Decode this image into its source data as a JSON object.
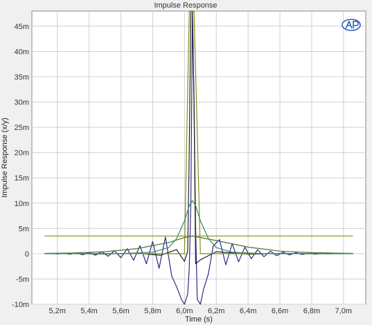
{
  "chart_data": {
    "type": "line",
    "title": "Impulse Response",
    "xlabel": "Time (s)",
    "ylabel": "Impulse Response (x/y)",
    "xlim": [
      5.04,
      7.14
    ],
    "ylim": [
      -10,
      48
    ],
    "x_unit": "ms-scaled seconds (m)",
    "y_unit": "m",
    "x_ticks": [
      {
        "v": 5.2,
        "label": "5,2m"
      },
      {
        "v": 5.4,
        "label": "5,4m"
      },
      {
        "v": 5.6,
        "label": "5,6m"
      },
      {
        "v": 5.8,
        "label": "5,8m"
      },
      {
        "v": 6.0,
        "label": "6,0m"
      },
      {
        "v": 6.2,
        "label": "6,2m"
      },
      {
        "v": 6.4,
        "label": "6,4m"
      },
      {
        "v": 6.6,
        "label": "6,6m"
      },
      {
        "v": 6.8,
        "label": "6,8m"
      },
      {
        "v": 7.0,
        "label": "7,0m"
      }
    ],
    "y_ticks": [
      {
        "v": 45,
        "label": "45m"
      },
      {
        "v": 40,
        "label": "40m"
      },
      {
        "v": 35,
        "label": "35m"
      },
      {
        "v": 30,
        "label": "30m"
      },
      {
        "v": 25,
        "label": "25m"
      },
      {
        "v": 20,
        "label": "20m"
      },
      {
        "v": 15,
        "label": "15m"
      },
      {
        "v": 10,
        "label": "10m"
      },
      {
        "v": 5,
        "label": "5m"
      },
      {
        "v": 0,
        "label": "0"
      },
      {
        "v": -5,
        "label": "-5m"
      },
      {
        "v": -10,
        "label": "-10m"
      }
    ],
    "grid": true,
    "series": [
      {
        "color": "#2a2a8a",
        "x": [
          5.12,
          5.16,
          5.2,
          5.24,
          5.28,
          5.32,
          5.36,
          5.4,
          5.44,
          5.48,
          5.52,
          5.56,
          5.6,
          5.64,
          5.68,
          5.72,
          5.76,
          5.8,
          5.84,
          5.88,
          5.92,
          5.95,
          5.98,
          6.0,
          6.02,
          6.03,
          6.04,
          6.05,
          6.06,
          6.07,
          6.08,
          6.1,
          6.12,
          6.15,
          6.18,
          6.22,
          6.26,
          6.3,
          6.34,
          6.38,
          6.42,
          6.46,
          6.5,
          6.54,
          6.58,
          6.62,
          6.66,
          6.7,
          6.74,
          6.78,
          6.82,
          6.86,
          6.9,
          6.94,
          6.98,
          7.02,
          7.06
        ],
        "y": [
          0,
          0.05,
          -0.05,
          0.08,
          -0.1,
          0.15,
          -0.2,
          0.25,
          -0.3,
          0.4,
          -0.5,
          0.6,
          -0.8,
          1.0,
          -1.3,
          1.6,
          -2.0,
          2.4,
          -2.9,
          3.3,
          -4.5,
          -6.5,
          -9,
          -10,
          -8,
          -3,
          10,
          48,
          30,
          5,
          -9,
          -10,
          -7,
          -4,
          1.5,
          2.8,
          -2.2,
          2.0,
          -1.6,
          1.3,
          -1.0,
          0.8,
          -0.6,
          0.5,
          -0.4,
          0.3,
          -0.25,
          0.2,
          -0.15,
          0.1,
          -0.08,
          0.05,
          -0.04,
          0.03,
          -0.02,
          0.01,
          0
        ]
      },
      {
        "color": "#222222",
        "x": [
          5.12,
          5.3,
          5.5,
          5.7,
          5.85,
          5.95,
          6.0,
          6.02,
          6.03,
          6.04,
          6.05,
          6.06,
          6.07,
          6.1,
          6.2,
          6.4,
          6.6,
          6.8,
          7.06
        ],
        "y": [
          0,
          0.02,
          -0.05,
          0.1,
          -0.3,
          0.8,
          -1.5,
          0.5,
          20,
          48,
          48,
          30,
          -2,
          -1.2,
          0.4,
          -0.1,
          0.05,
          -0.02,
          0
        ]
      },
      {
        "color": "#8a8a1a",
        "x": [
          5.12,
          5.2,
          5.4,
          5.6,
          5.8,
          5.95,
          6.0,
          6.03,
          6.04,
          6.05,
          6.06,
          6.1,
          6.3,
          6.5,
          6.7,
          6.9,
          7.06
        ],
        "y": [
          0,
          0,
          0,
          0,
          0,
          0,
          0,
          48,
          48,
          48,
          48,
          0,
          0,
          0,
          0,
          0,
          0
        ]
      },
      {
        "color": "#8a8a1a",
        "x": [
          5.12,
          7.06
        ],
        "y": [
          3.5,
          3.5
        ]
      },
      {
        "color": "#556b2f",
        "x": [
          5.12,
          5.3,
          5.5,
          5.7,
          5.9,
          6.0,
          6.05,
          6.1,
          6.2,
          6.4,
          6.6,
          6.8,
          7.06
        ],
        "y": [
          0.05,
          0.15,
          0.4,
          1.0,
          2.2,
          3.2,
          3.5,
          3.2,
          2.6,
          1.3,
          0.5,
          0.2,
          0.05
        ]
      },
      {
        "color": "#2e8b57",
        "x": [
          5.12,
          5.6,
          5.8,
          5.9,
          5.95,
          6.0,
          6.03,
          6.05,
          6.07,
          6.1,
          6.15,
          6.2,
          6.3,
          6.5,
          7.06
        ],
        "y": [
          0,
          0,
          0.3,
          1.2,
          3,
          6.5,
          9.5,
          10.5,
          9.5,
          6.5,
          3,
          1.2,
          0.3,
          0,
          0
        ]
      }
    ]
  }
}
